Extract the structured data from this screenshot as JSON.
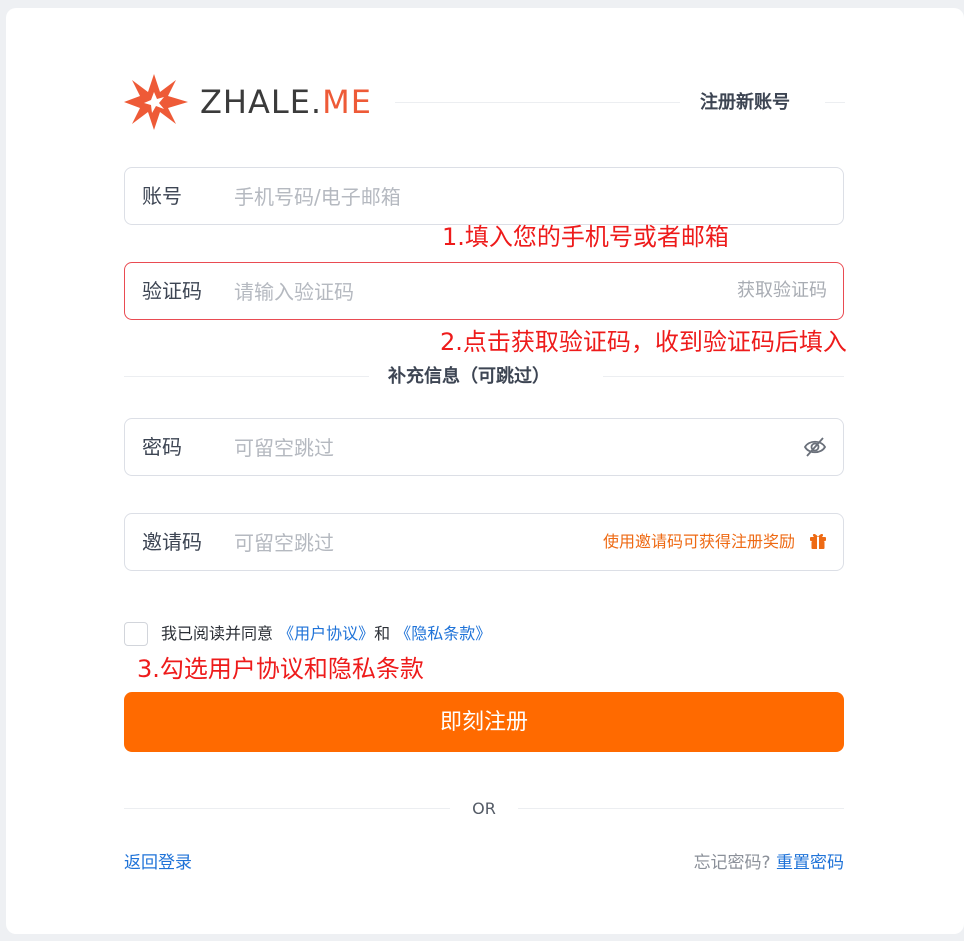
{
  "brand": {
    "name_main": "ZHALE.",
    "name_accent": "ME",
    "accent_color": "#ee5a37"
  },
  "header": {
    "title": "注册新账号"
  },
  "fields": {
    "account": {
      "label": "账号",
      "placeholder": "手机号码/电子邮箱",
      "value": ""
    },
    "code": {
      "label": "验证码",
      "placeholder": "请输入验证码",
      "value": "",
      "action": "获取验证码"
    },
    "password": {
      "label": "密码",
      "placeholder": "可留空跳过",
      "value": ""
    },
    "invite": {
      "label": "邀请码",
      "placeholder": "可留空跳过",
      "value": "",
      "hint": "使用邀请码可获得注册奖励"
    }
  },
  "section": {
    "optional_title": "补充信息（可跳过）"
  },
  "annotations": {
    "step1": "1.填入您的手机号或者邮箱",
    "step2": "2.点击获取验证码，收到验证码后填入",
    "step3": "3.勾选用户协议和隐私条款"
  },
  "agreement": {
    "prefix": "我已阅读并同意",
    "terms_link": "《用户协议》",
    "and": "和",
    "privacy_link": "《隐私条款》",
    "checked": false
  },
  "actions": {
    "submit": "即刻注册",
    "divider": "OR"
  },
  "footer": {
    "back_login": "返回登录",
    "forgot_text": "忘记密码?",
    "reset_link": "重置密码"
  },
  "colors": {
    "primary": "#ff6a00",
    "link": "#1f73d8",
    "error_border": "#e94b52",
    "annotation": "#ee1b1b"
  }
}
